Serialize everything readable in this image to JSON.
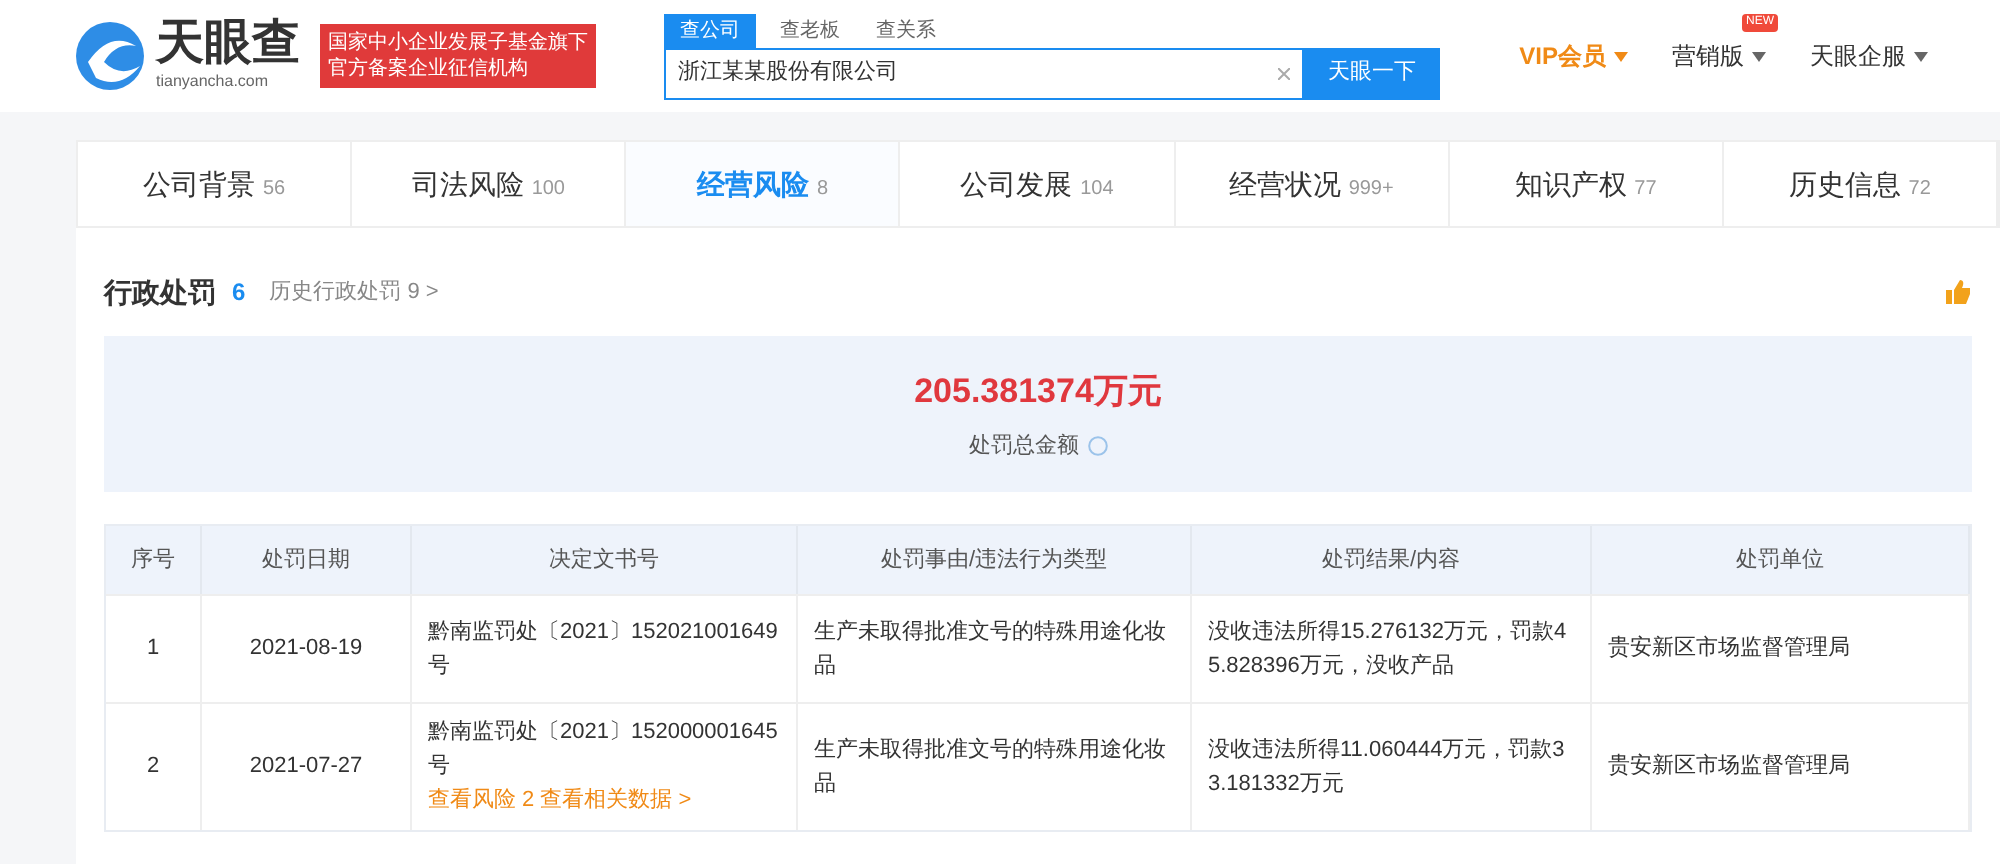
{
  "logo": {
    "name": "天眼查",
    "domain": "tianyancha.com"
  },
  "banner": {
    "lines": [
      "国家中小企业发展子基金旗下",
      "官方备案企业征信机构"
    ]
  },
  "search": {
    "tabs": [
      {
        "label": "查公司",
        "selected": true
      },
      {
        "label": "查老板",
        "selected": false
      },
      {
        "label": "查关系",
        "selected": false
      }
    ],
    "value": "浙江某某股份有限公司",
    "button": "天眼一下"
  },
  "top_links": [
    {
      "label": "VIP会员",
      "kind": "vip"
    },
    {
      "label": "营销版",
      "kind": "new",
      "badge": "NEW"
    },
    {
      "label": "天眼企服",
      "kind": "plain"
    }
  ],
  "nav_tabs": [
    {
      "label": "公司背景",
      "count": "56",
      "selected": false
    },
    {
      "label": "司法风险",
      "count": "100",
      "selected": false
    },
    {
      "label": "经营风险",
      "count": "8",
      "selected": true
    },
    {
      "label": "公司发展",
      "count": "104",
      "selected": false
    },
    {
      "label": "经营状况",
      "count": "999+",
      "selected": false
    },
    {
      "label": "知识产权",
      "count": "77",
      "selected": false
    },
    {
      "label": "历史信息",
      "count": "72",
      "selected": false
    }
  ],
  "section": {
    "title": "行政处罚",
    "count": "6",
    "history_link": "历史行政处罚 9 >"
  },
  "summary": {
    "amount": "205.381374万元",
    "label": "处罚总金额"
  },
  "table": {
    "columns": [
      "序号",
      "处罚日期",
      "决定文书号",
      "处罚事由/违法行为类型",
      "处罚结果/内容",
      "处罚单位"
    ],
    "rows": [
      {
        "cells": [
          "1",
          "2021-08-19",
          "黔南监罚处〔2021〕152021001649号",
          "生产未取得批准文号的特殊用途化妆品",
          "没收违法所得15.276132万元，罚款45.828396万元，没收产品",
          "贵安新区市场监督管理局"
        ]
      },
      {
        "cells": [
          "2",
          "2021-07-27",
          "黔南监罚处〔2021〕152000001645号",
          "生产未取得批准文号的特殊用途化妆品",
          "没收违法所得11.060444万元，罚款33.181332万元",
          "贵安新区市场监督管理局"
        ],
        "risk_link": "查看风险 2 查看相关数据 >"
      }
    ]
  }
}
